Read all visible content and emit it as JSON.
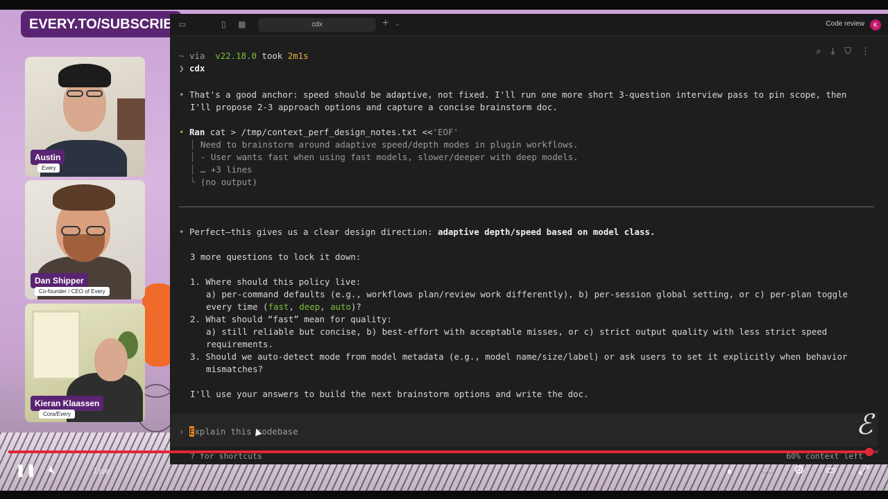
{
  "banner": {
    "text": "EVERY.TO/SUBSCRIBE"
  },
  "participants": [
    {
      "name": "Austin",
      "role": "Every"
    },
    {
      "name": "Dan Shipper",
      "role": "Co-founder / CEO of Every"
    },
    {
      "name": "Kieran Klaassen",
      "role": "Cora/Every"
    }
  ],
  "window": {
    "tab_title": "cdx",
    "code_review_label": "Code review",
    "avatar_initial": "K"
  },
  "terminal": {
    "prompt_line": {
      "tilde": "~",
      "via": "via",
      "node_version": "v22.18.0",
      "took": "took",
      "duration": "2m1s"
    },
    "command": "cdx",
    "msg1_line1": "That's a good anchor: speed should be adaptive, not fixed. I'll run one more short 3-question interview pass to pin scope, then",
    "msg1_line2": "I'll propose 2-3 approach options and capture a concise brainstorm doc.",
    "ran_label": "Ran",
    "ran_cmd": "cat > /tmp/context_perf_design_notes.txt <<",
    "ran_heredoc": "'EOF'",
    "out_line1": "Need to brainstorm around adaptive speed/depth modes in plugin workflows.",
    "out_line2": "- User wants fast when using fast models, slower/deeper with deep models.",
    "out_line3": "… +3 lines",
    "out_line4": "(no output)",
    "msg2_prefix": "Perfect—this gives us a clear design direction: ",
    "msg2_bold": "adaptive depth/speed based on model class.",
    "q_intro": "3 more questions to lock it down:",
    "q1_title": "1. Where should this policy live:",
    "q1_line1": "a) per-command defaults (e.g., workflows plan/review work differently), b) per-session global setting, or c) per-plan toggle",
    "q1_line2_prefix": "every time (",
    "q1_opt1": "fast",
    "q1_opt2": "deep",
    "q1_opt3": "auto",
    "q1_line2_suffix": ")?",
    "q2_title": "2. What should “fast” mean for quality:",
    "q2_line1": "a) still reliable but concise, b) best-effort with acceptable misses, or c) strict output quality with less strict speed",
    "q2_line2": "requirements.",
    "q3_line1": "3. Should we auto-detect mode from model metadata (e.g., model name/size/label) or ask users to set it explicitly when behavior",
    "q3_line2": "mismatches?",
    "closing": "I'll use your answers to build the next brainstorm options and write the doc.",
    "input_placeholder": "xplain this codebase",
    "input_first_char": "E",
    "footer_hint": "? for shortcuts",
    "context_left": "60% context left"
  },
  "player": {
    "live_label": "Live",
    "progress": 0.99
  },
  "colors": {
    "brand_purple": "#5a2472",
    "node_green": "#7fbf3c",
    "duration_yellow": "#e3b341",
    "progress_red": "#e32636"
  }
}
